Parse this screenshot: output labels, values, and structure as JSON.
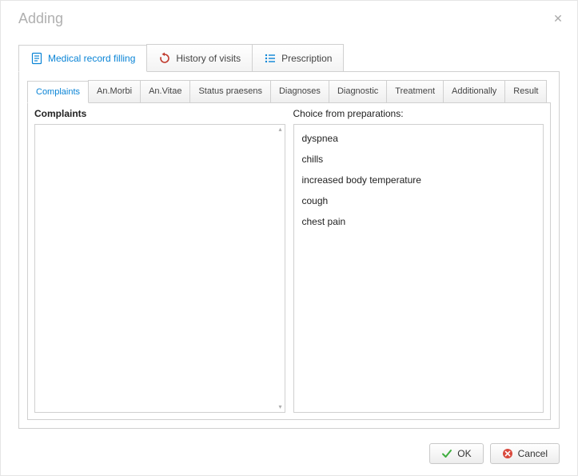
{
  "dialog": {
    "title": "Adding"
  },
  "top_tabs": {
    "medical": {
      "label": "Medical record filling",
      "icon": "document-icon"
    },
    "history": {
      "label": "History of visits",
      "icon": "refresh-icon"
    },
    "prescription": {
      "label": "Prescription",
      "icon": "list-icon"
    }
  },
  "sub_tabs": {
    "items": [
      {
        "label": "Complaints"
      },
      {
        "label": "An.Morbi"
      },
      {
        "label": "An.Vitae"
      },
      {
        "label": "Status praesens"
      },
      {
        "label": "Diagnoses"
      },
      {
        "label": "Diagnostic"
      },
      {
        "label": "Treatment"
      },
      {
        "label": "Additionally"
      },
      {
        "label": "Result"
      }
    ],
    "active_index": 0
  },
  "complaints": {
    "label": "Complaints",
    "value": ""
  },
  "choice": {
    "label": "Choice from preparations:",
    "items": [
      "dyspnea",
      "chills",
      "increased body temperature",
      "cough",
      "chest pain"
    ]
  },
  "buttons": {
    "ok": "OK",
    "cancel": "Cancel"
  }
}
